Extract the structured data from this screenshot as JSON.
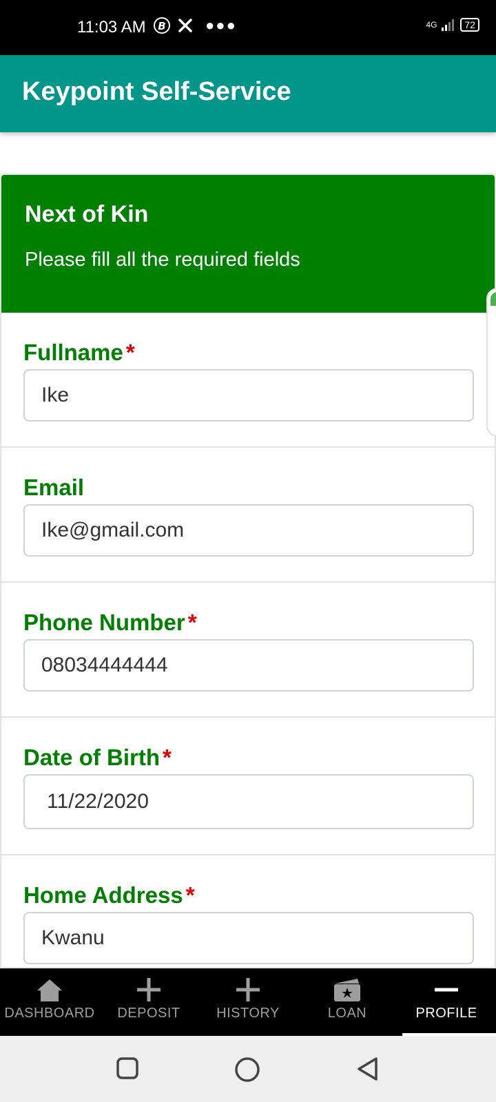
{
  "status_bar": {
    "time": "11:03 AM",
    "network": "4G",
    "battery": "72"
  },
  "app_bar": {
    "title": "Keypoint Self-Service"
  },
  "card": {
    "title": "Next of Kin",
    "subtitle": "Please fill all the required fields"
  },
  "fields": [
    {
      "label": "Fullname",
      "required": true,
      "value": "Ike"
    },
    {
      "label": "Email",
      "required": false,
      "value": "Ike@gmail.com"
    },
    {
      "label": "Phone Number",
      "required": true,
      "value": "08034444444"
    },
    {
      "label": "Date of Birth",
      "required": true,
      "value": "11/22/2020"
    },
    {
      "label": "Home Address",
      "required": true,
      "value": "Kwanu"
    }
  ],
  "required_marker": "*",
  "bottom_nav": [
    {
      "label": "DASHBOARD",
      "icon": "home-icon",
      "active": false
    },
    {
      "label": "DEPOSIT",
      "icon": "plus-icon",
      "active": false
    },
    {
      "label": "HISTORY",
      "icon": "plus-icon",
      "active": false
    },
    {
      "label": "LOAN",
      "icon": "wallet-icon",
      "active": false
    },
    {
      "label": "PROFILE",
      "icon": "minus-icon",
      "active": true
    }
  ],
  "colors": {
    "app_bar": "#00968a",
    "card_header": "#008000",
    "label": "#008000",
    "required": "#e00000"
  }
}
